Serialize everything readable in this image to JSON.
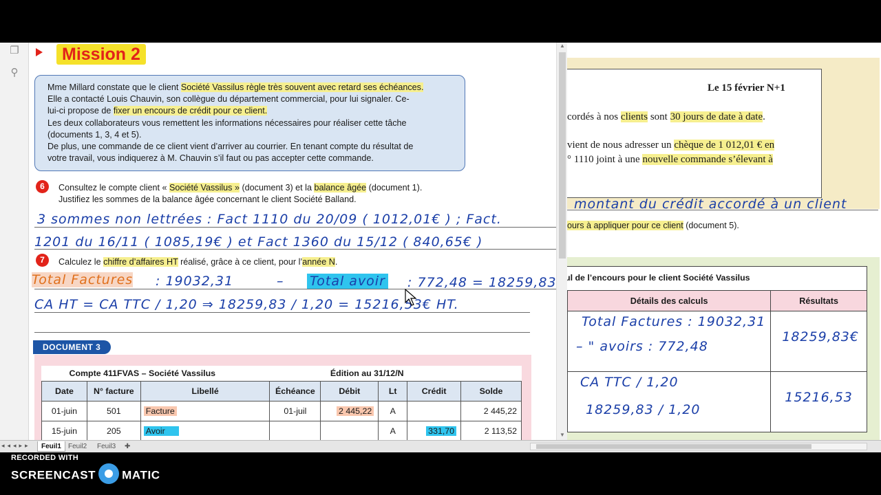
{
  "mission": {
    "title": "Mission 2",
    "intro_lines": [
      [
        "Mme Millard constate que le client ",
        "Société Vassilus règle très souvent avec retard ses échéances."
      ],
      [
        "Elle a contacté Louis Chauvin, son collègue du département commercial, pour lui signaler. Ce-",
        ""
      ],
      [
        "lui-ci propose de ",
        "fixer un encours de crédit pour ce client."
      ],
      [
        "Les deux collaborateurs vous remettent les informations nécessaires pour réaliser cette tâche",
        ""
      ],
      [
        "(documents 1, 3, 4 et 5).",
        ""
      ],
      [
        "De plus, une commande de ce client vient d’arriver au courrier. En tenant compte du résultat de",
        ""
      ],
      [
        "votre travail, vous indiquerez à M. Chauvin s’il faut ou pas accepter cette commande.",
        ""
      ]
    ]
  },
  "q6": {
    "number": "6",
    "line1_parts": [
      "Consultez le compte client « ",
      "Société Vassilus »",
      " (document 3) et la ",
      "balance âgée",
      " (document 1)."
    ],
    "line2": "Justifiez les sommes de la balance âgée concernant le client Société Balland.",
    "hw1": "3 sommes non lettrées : Fact 1110 du 20/09 ( 1012,01€ ) ; Fact.",
    "hw2": "1201 du 16/11 ( 1085,19€ ) et Fact 1360 du 15/12 ( 840,65€ )"
  },
  "q7": {
    "number": "7",
    "parts": [
      "Calculez le ",
      "chiffre d’affaires HT",
      " réalisé, grâce à ce client, pour l’",
      "année N",
      "."
    ],
    "hw_total_factures": "Total Factures",
    "hw_line1_a": ": 19032,31",
    "hw_line1_b": "–",
    "hw_total_avoir": "Total avoir",
    "hw_line1_c": ": 772,48 = 18259,83",
    "hw_line2": "CA HT = CA TTC / 1,20 ⇒ 18259,83 / 1,20 = 15216,53€ HT."
  },
  "document3": {
    "label": "DOCUMENT 3",
    "account_title": "Compte 411FVAS – Société Vassilus",
    "edition": "Édition au 31/12/N",
    "headers": [
      "Date",
      "N° facture",
      "Libellé",
      "Échéance",
      "Débit",
      "Lt",
      "Crédit",
      "Solde"
    ],
    "rows": [
      [
        "01-juin",
        "501",
        "Facture",
        "01-juil",
        "2 445,22",
        "A",
        "",
        "2 445,22"
      ],
      [
        "15-juin",
        "205",
        "Avoir",
        "",
        "",
        "A",
        "331,70",
        "2 113,52"
      ]
    ]
  },
  "right_page": {
    "date": "Le 15 février N+1",
    "line1_parts": [
      "cordés à nos ",
      "clients",
      " sont ",
      "30 jours de date à date",
      "."
    ],
    "line2_parts": [
      "vient de nous adresser un ",
      "chèque de 1 012,01 € en"
    ],
    "line3_parts": [
      "° 1110 joint à une ",
      "nouvelle commande s’élevant à"
    ],
    "hw_heading": "montant du crédit accordé à un client",
    "line4_parts": [
      "ours à appliquer pour ce client",
      " (document 5)."
    ],
    "table_title": "ul de l’encours pour le client Société Vassilus",
    "col_details": "Détails des calculs",
    "col_results": "Résultats",
    "hw_r1_a": "Total Factures : 19032,31",
    "hw_r1_b": "– \" avoirs : 772,48",
    "hw_r1_result": "18259,83€",
    "hw_r2_a": "CA TTC / 1,20",
    "hw_r2_b": "18259,83 / 1,20",
    "hw_r2_result": "15216,53"
  },
  "sheets": [
    "Feuil1",
    "Feuil2",
    "Feuil3"
  ],
  "watermark": {
    "recorded_with": "RECORDED WITH",
    "brand_left": "SCREENCAST",
    "brand_right": "MATIC"
  },
  "icons": {
    "left_strip": [
      "pages-icon",
      "attachment-icon"
    ]
  }
}
